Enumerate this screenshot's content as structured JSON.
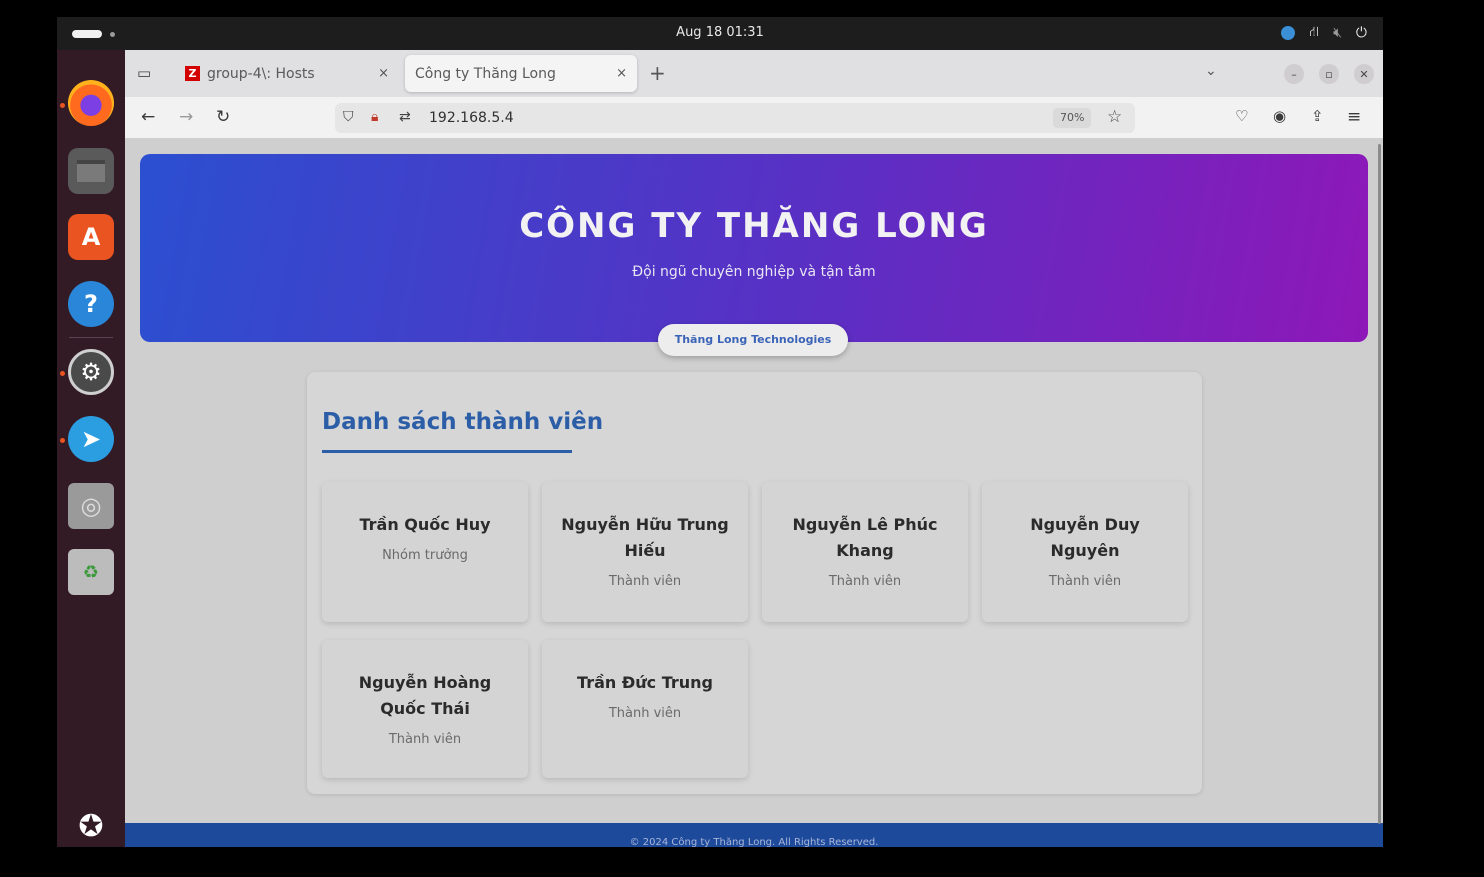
{
  "system": {
    "clock": "Aug 18  01:31"
  },
  "dock": {
    "items": [
      "firefox-icon",
      "files-icon",
      "app-center-icon",
      "help-icon",
      "settings-icon",
      "telegram-icon",
      "disc-icon",
      "trash-icon",
      "show-apps-icon"
    ]
  },
  "browser": {
    "tabs": [
      {
        "favicon": "Z",
        "title": "group-4\\: Hosts",
        "close": "×"
      },
      {
        "title": "Công ty Thăng Long",
        "close": "×"
      }
    ],
    "new_tab": "+",
    "url": "192.168.5.4",
    "zoom": "70%"
  },
  "page": {
    "hero_title": "CÔNG TY THĂNG LONG",
    "hero_subtitle": "Đội ngũ chuyên nghiệp và tận tâm",
    "badge": "Thăng Long Technologies",
    "section_title": "Danh sách thành viên",
    "members": [
      {
        "name": "Trần Quốc Huy",
        "role": "Nhóm trưởng"
      },
      {
        "name": "Nguyễn Hữu Trung Hiếu",
        "role": "Thành viên"
      },
      {
        "name": "Nguyễn Lê Phúc Khang",
        "role": "Thành viên"
      },
      {
        "name": "Nguyễn Duy Nguyên",
        "role": "Thành viên"
      },
      {
        "name": "Nguyễn Hoàng Quốc Thái",
        "role": "Thành viên"
      },
      {
        "name": "Trần Đức Trung",
        "role": "Thành viên"
      }
    ],
    "footer": "© 2024 Công ty Thăng Long. All Rights Reserved."
  }
}
